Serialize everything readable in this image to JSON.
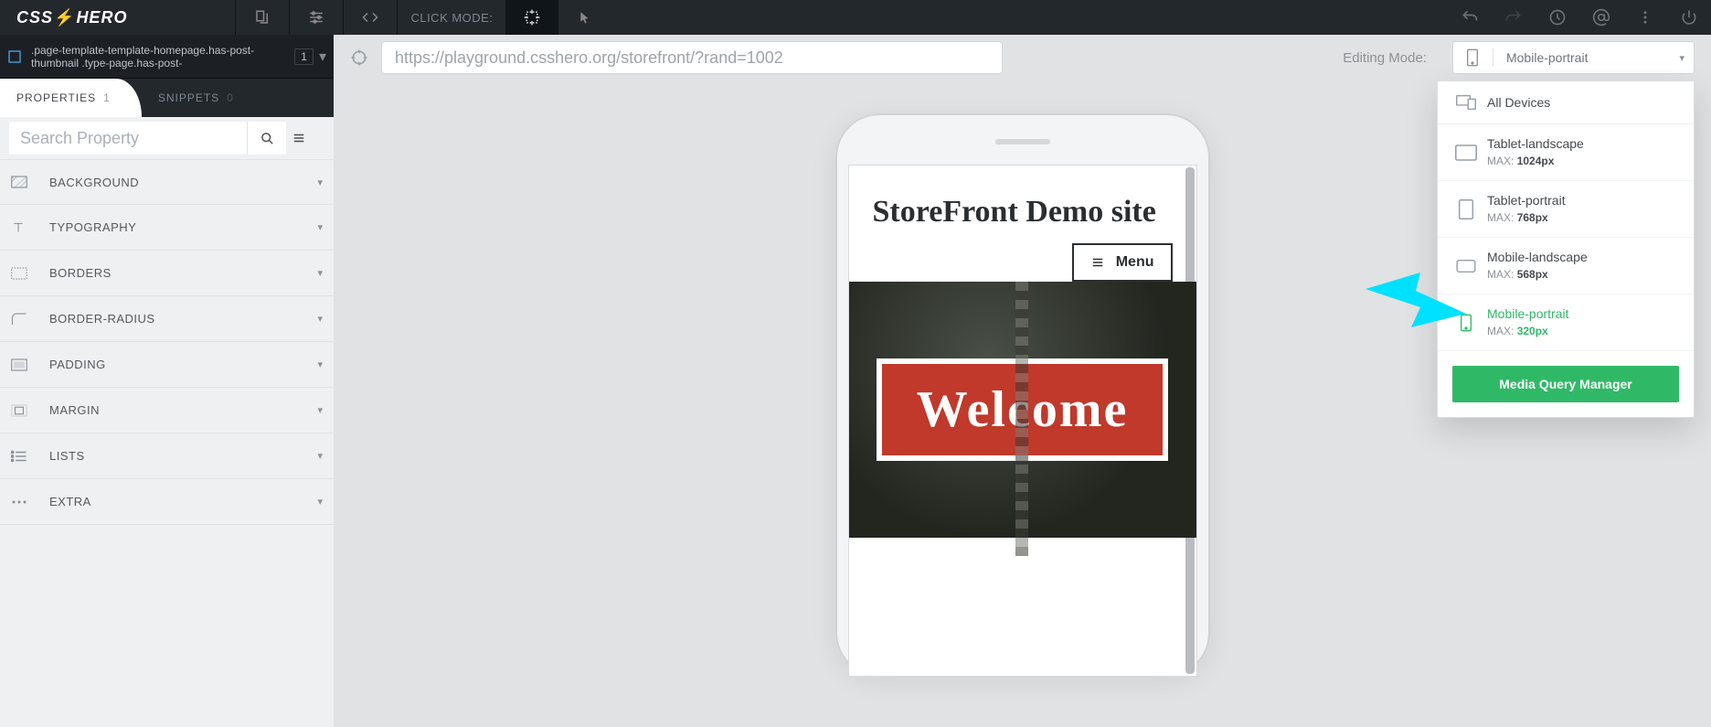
{
  "brand": {
    "name_a": "CSS",
    "name_b": "HERO"
  },
  "click_mode_label": "CLICK MODE:",
  "selector": {
    "text": ".page-template-template-homepage.has-post-thumbnail .type-page.has-post-",
    "count": "1"
  },
  "tabs": {
    "properties_label": "PROPERTIES",
    "properties_count": "1",
    "snippets_label": "SNIPPETS",
    "snippets_count": "0"
  },
  "search": {
    "placeholder": "Search Property"
  },
  "prop_groups": [
    "BACKGROUND",
    "TYPOGRAPHY",
    "BORDERS",
    "BORDER-RADIUS",
    "PADDING",
    "MARGIN",
    "LISTS",
    "EXTRA"
  ],
  "url": "https://playground.csshero.org/storefront/?rand=1002",
  "editing_mode_label": "Editing Mode:",
  "editing_selected": "Mobile-portrait",
  "devices": {
    "all_label": "All Devices",
    "list": [
      {
        "name": "Tablet-landscape",
        "max": "1024px"
      },
      {
        "name": "Tablet-portrait",
        "max": "768px"
      },
      {
        "name": "Mobile-landscape",
        "max": "568px"
      },
      {
        "name": "Mobile-portrait",
        "max": "320px"
      }
    ],
    "max_label": "MAX:",
    "manager_button": "Media Query Manager"
  },
  "preview": {
    "site_title": "StoreFront Demo site",
    "menu_label": "Menu",
    "welcome": "Welcome"
  }
}
